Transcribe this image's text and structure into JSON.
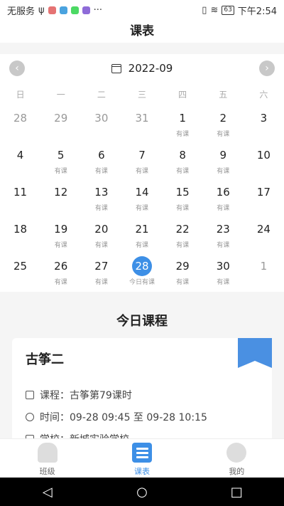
{
  "status_bar": {
    "carrier": "无服务",
    "time": "下午2:54",
    "battery": "63",
    "more": "···",
    "dot_colors": [
      "#e57373",
      "#4aa3df",
      "#4cd964",
      "#8e6bd8"
    ]
  },
  "page_title": "课表",
  "calendar": {
    "month": "2022-09",
    "prev": "‹",
    "next": "›",
    "weekdays": [
      "日",
      "一",
      "二",
      "三",
      "四",
      "五",
      "六"
    ],
    "days": [
      {
        "n": "28",
        "note": "",
        "muted": true
      },
      {
        "n": "29",
        "note": "",
        "muted": true
      },
      {
        "n": "30",
        "note": "",
        "muted": true
      },
      {
        "n": "31",
        "note": "",
        "muted": true
      },
      {
        "n": "1",
        "note": "有课"
      },
      {
        "n": "2",
        "note": "有课"
      },
      {
        "n": "3",
        "note": ""
      },
      {
        "n": "4",
        "note": ""
      },
      {
        "n": "5",
        "note": "有课"
      },
      {
        "n": "6",
        "note": "有课"
      },
      {
        "n": "7",
        "note": "有课"
      },
      {
        "n": "8",
        "note": "有课"
      },
      {
        "n": "9",
        "note": "有课"
      },
      {
        "n": "10",
        "note": ""
      },
      {
        "n": "11",
        "note": ""
      },
      {
        "n": "12",
        "note": ""
      },
      {
        "n": "13",
        "note": "有课"
      },
      {
        "n": "14",
        "note": "有课"
      },
      {
        "n": "15",
        "note": "有课"
      },
      {
        "n": "16",
        "note": "有课"
      },
      {
        "n": "17",
        "note": ""
      },
      {
        "n": "18",
        "note": ""
      },
      {
        "n": "19",
        "note": "有课"
      },
      {
        "n": "20",
        "note": "有课"
      },
      {
        "n": "21",
        "note": "有课"
      },
      {
        "n": "22",
        "note": "有课"
      },
      {
        "n": "23",
        "note": "有课"
      },
      {
        "n": "24",
        "note": ""
      },
      {
        "n": "25",
        "note": ""
      },
      {
        "n": "26",
        "note": "有课"
      },
      {
        "n": "27",
        "note": "有课"
      },
      {
        "n": "28",
        "note": "今日有课",
        "today": true
      },
      {
        "n": "29",
        "note": "有课"
      },
      {
        "n": "30",
        "note": "有课"
      },
      {
        "n": "1",
        "note": "",
        "muted": true
      }
    ]
  },
  "today": {
    "title": "今日课程",
    "course_name": "古筝二",
    "course_label": "课程：",
    "course_value": "古筝第79课时",
    "time_label": "时间：",
    "time_value": "09-28 09:45 至 09-28 10:15",
    "school_label": "学校：",
    "school_value": "新城实验学校"
  },
  "tabs": [
    {
      "label": "班级",
      "icon": "class-icon"
    },
    {
      "label": "课表",
      "icon": "schedule-icon"
    },
    {
      "label": "我的",
      "icon": "mine-icon"
    }
  ],
  "nav": {
    "back": "◁",
    "home": "○",
    "recent": "□"
  }
}
